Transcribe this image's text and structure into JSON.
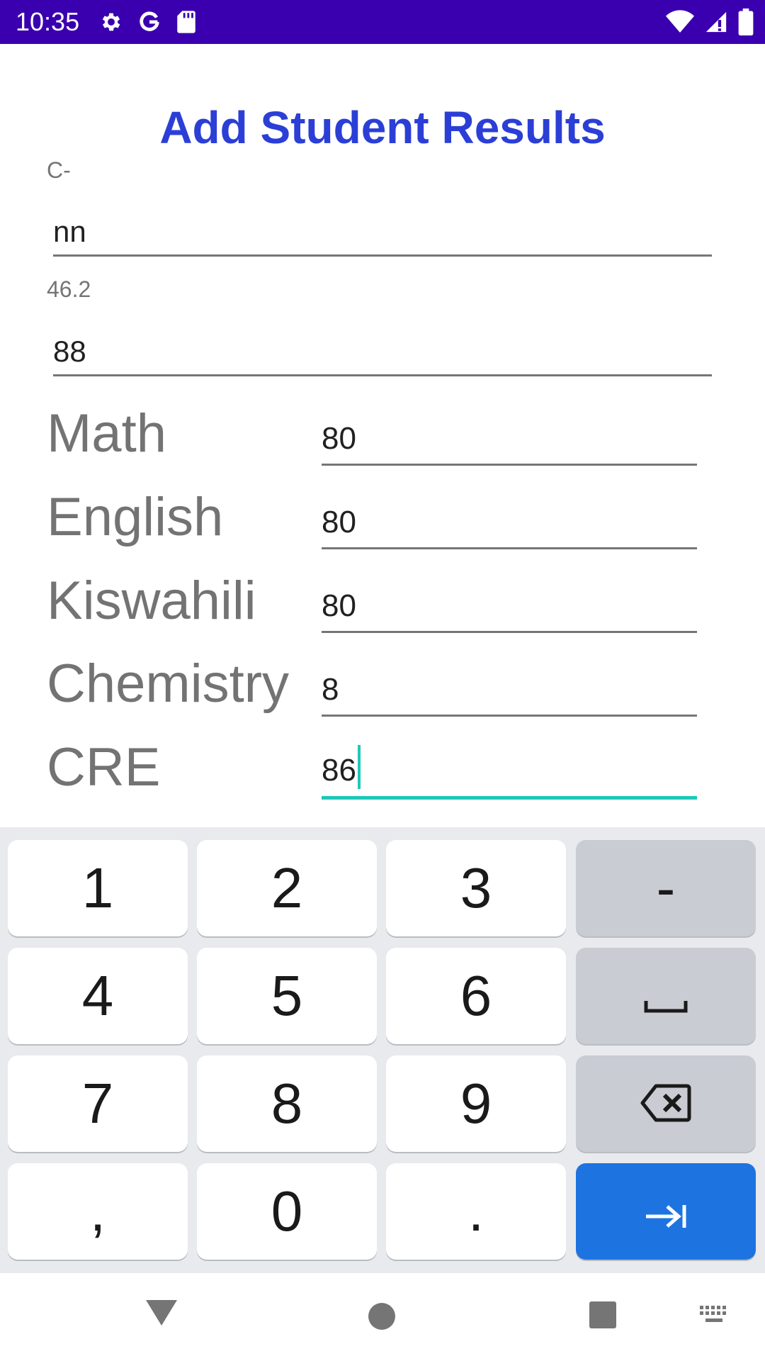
{
  "status_bar": {
    "time": "10:35",
    "icons_left": [
      "settings-icon",
      "google-icon",
      "sd-card-icon"
    ],
    "icons_right": [
      "wifi-icon",
      "signal-icon",
      "battery-icon"
    ],
    "color": "#3a00b0"
  },
  "app": {
    "title": "Add Student Results",
    "title_color": "#2b3fd6",
    "grade_label": "C-",
    "name_value": "nn",
    "average_label": "46.2",
    "adm_value": "88",
    "subjects": [
      {
        "label": "Math",
        "value": "80"
      },
      {
        "label": "English",
        "value": "80"
      },
      {
        "label": "Kiswahili",
        "value": "80"
      },
      {
        "label": "Chemistry",
        "value": "8"
      },
      {
        "label": "CRE",
        "value": "86"
      }
    ],
    "focus_color": "#1ec8b8"
  },
  "keyboard": {
    "rows": [
      [
        "1",
        "2",
        "3",
        "-"
      ],
      [
        "4",
        "5",
        "6",
        "space-icon"
      ],
      [
        "7",
        "8",
        "9",
        "backspace-icon"
      ],
      [
        ",",
        "0",
        ".",
        "tab-next-icon"
      ]
    ],
    "action_color": "#1d74e0"
  },
  "nav_bar": {
    "buttons": [
      "back-triangle-icon",
      "home-circle-icon",
      "recents-square-icon",
      "keyboard-switch-icon"
    ]
  }
}
